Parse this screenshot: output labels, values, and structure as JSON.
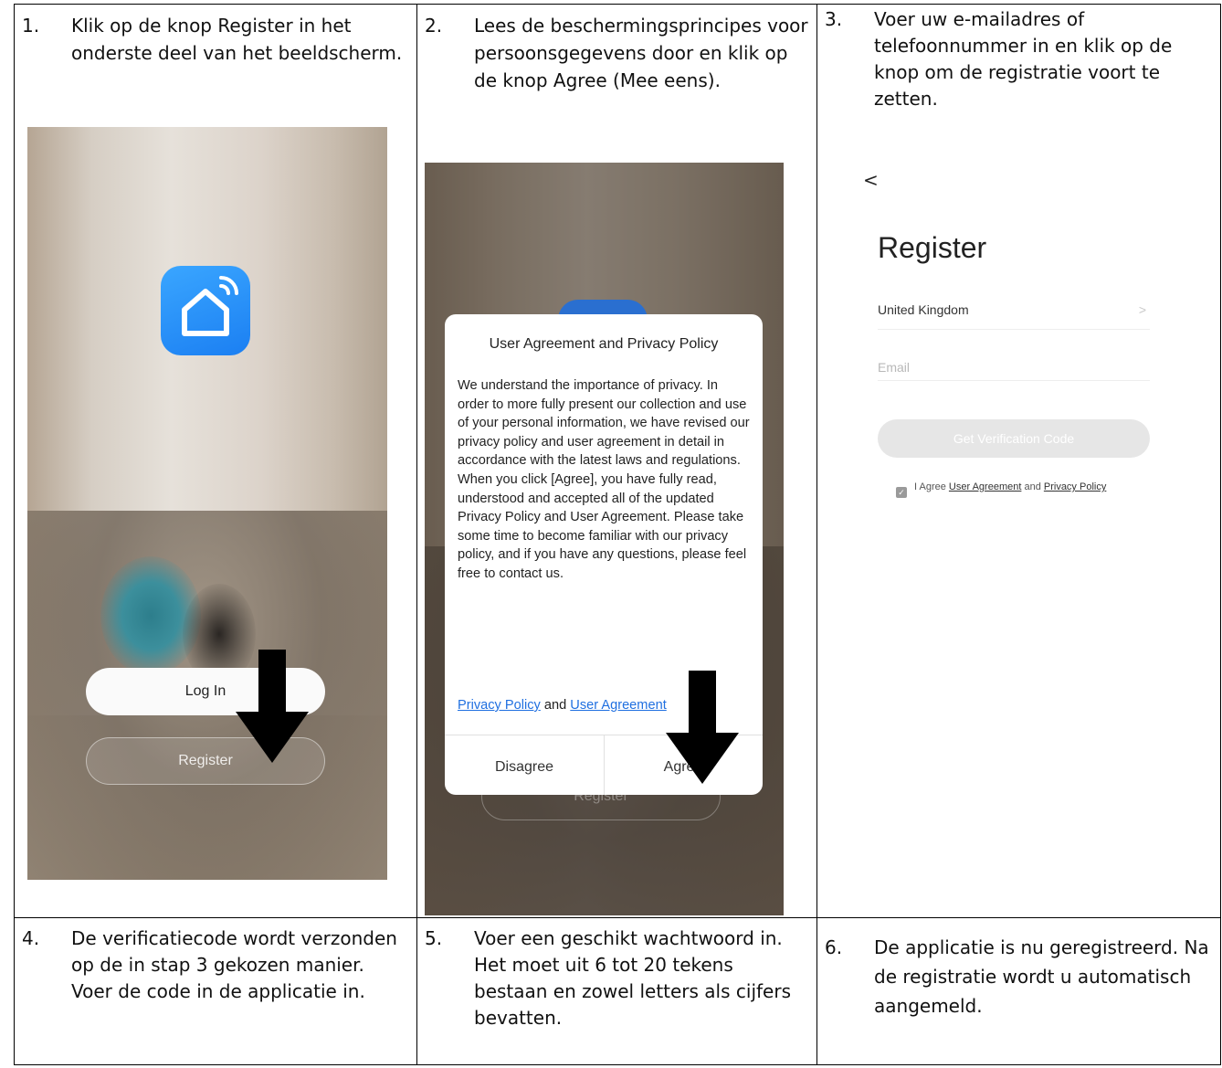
{
  "steps": [
    {
      "num": "1.",
      "text": "Klik op de knop Register in het onderste deel van het beeldscherm."
    },
    {
      "num": "2.",
      "text": "Lees de beschermingsprincipes voor persoonsgegevens door en klik op de knop Agree (Mee eens)."
    },
    {
      "num": "3.",
      "text": "Voer uw e-mailadres of telefoonnummer in en klik op de knop om de registratie voort te zetten."
    },
    {
      "num": "4.",
      "text": "De verificatiecode wordt verzonden op de in stap 3 gekozen manier. Voer de code in de applicatie in."
    },
    {
      "num": "5.",
      "text": "Voer een geschikt wachtwoord in. Het moet uit 6 tot 20 tekens bestaan en zowel letters als cijfers bevatten."
    },
    {
      "num": "6.",
      "text": "De applicatie is nu geregistreerd. Na de registratie wordt u automatisch aangemeld."
    }
  ],
  "screen1": {
    "login_label": "Log In",
    "register_label": "Register"
  },
  "screen2": {
    "dialog_title": "User Agreement and Privacy Policy",
    "dialog_body": "We understand the importance of privacy. In order to more fully present our collection and use of your personal information, we have revised our privacy policy and user agreement in detail in accordance with the latest laws and regulations. When you click [Agree], you have fully read, understood and accepted all of the updated Privacy Policy and User Agreement. Please take some time to become familiar with our privacy policy, and if you have any questions, please feel free to contact us.",
    "privacy_link": "Privacy Policy",
    "and_text": " and ",
    "user_agreement_link": "User Agreement",
    "disagree_label": "Disagree",
    "agree_label": "Agree",
    "register_behind": "Register"
  },
  "screen3": {
    "back_glyph": "<",
    "title": "Register",
    "country": "United Kingdom",
    "country_chevron": ">",
    "email_placeholder": "Email",
    "get_code_label": "Get Verification Code",
    "agree_prefix": "I Agree ",
    "user_agreement_link": "User Agreement",
    "agree_and": " and ",
    "privacy_link": "Privacy Policy"
  },
  "colors": {
    "app_icon_blue": "#1b7ff2",
    "link_blue": "#1f6fe0"
  },
  "icons": [
    "app-home-wifi-icon",
    "down-arrow-icon",
    "back-chevron-icon",
    "chevron-right-icon",
    "checkbox-checked-icon"
  ]
}
